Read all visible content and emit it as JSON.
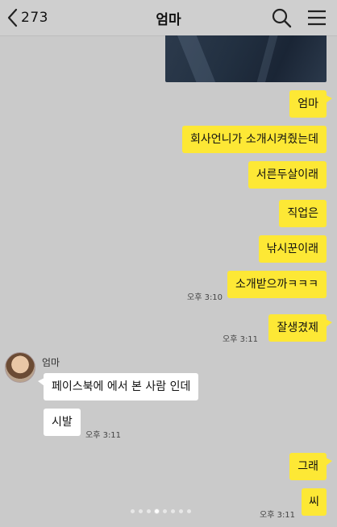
{
  "header": {
    "back_count": "273",
    "title": "엄마"
  },
  "messages": [
    {
      "text": "엄마"
    },
    {
      "text": "회사언니가 소개시켜줬는데"
    },
    {
      "text": "서른두살이래"
    },
    {
      "text": "직업은"
    },
    {
      "text": "낚시꾼이래"
    },
    {
      "text": "소개받으까ㅋㅋㅋ",
      "time": "오후 3:10"
    },
    {
      "text": "잘생겼제",
      "time": "오후 3:11"
    }
  ],
  "received": {
    "sender": "엄마",
    "messages": [
      {
        "text": "페이스북에 에서 본 사람 인데"
      },
      {
        "text": "시발",
        "time": "오후 3:11"
      }
    ]
  },
  "replies": [
    {
      "text": "그래"
    },
    {
      "text": "씨",
      "time": "오후 3:11"
    }
  ],
  "pager": {
    "total": 8,
    "active_index": 3
  },
  "colors": {
    "background": "#cacaca",
    "my_bubble": "#fde835",
    "their_bubble": "#ffffff"
  }
}
